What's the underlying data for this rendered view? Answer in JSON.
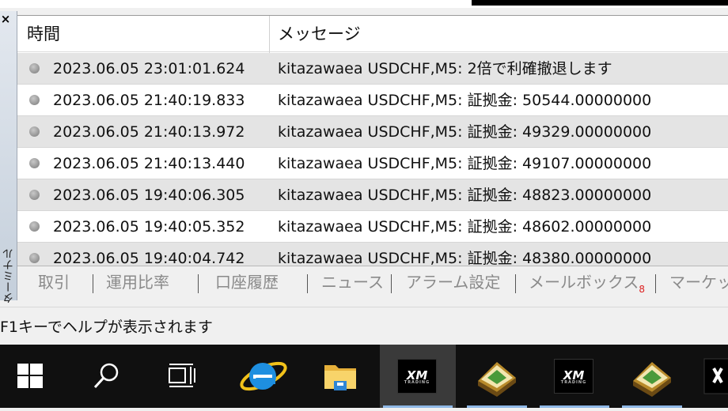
{
  "panel": {
    "close_glyph": "×",
    "side_label": "ターミナル"
  },
  "table": {
    "columns": [
      "時間",
      "メッセージ"
    ],
    "rows": [
      {
        "time": "2023.06.05 23:01:01.624",
        "message": "kitazawaea USDCHF,M5: 2倍で利確撤退します"
      },
      {
        "time": "2023.06.05 21:40:19.833",
        "message": "kitazawaea USDCHF,M5: 証拠金: 50544.00000000"
      },
      {
        "time": "2023.06.05 21:40:13.972",
        "message": "kitazawaea USDCHF,M5: 証拠金: 49329.00000000"
      },
      {
        "time": "2023.06.05 21:40:13.440",
        "message": "kitazawaea USDCHF,M5: 証拠金: 49107.00000000"
      },
      {
        "time": "2023.06.05 19:40:06.305",
        "message": "kitazawaea USDCHF,M5: 証拠金: 48823.00000000"
      },
      {
        "time": "2023.06.05 19:40:05.352",
        "message": "kitazawaea USDCHF,M5: 証拠金: 48602.00000000"
      },
      {
        "time": "2023.06.05 19:40:04.742",
        "message": "kitazawaea USDCHF,M5: 証拠金: 48380.00000000"
      }
    ]
  },
  "tabs": [
    {
      "label": "取引"
    },
    {
      "label": "運用比率"
    },
    {
      "label": "口座履歴"
    },
    {
      "label": "ニュース"
    },
    {
      "label": "アラーム設定"
    },
    {
      "label": "メールボックス",
      "badge": "8"
    },
    {
      "label": "マーケット"
    }
  ],
  "status_text": "F1キーでヘルプが表示されます",
  "taskbar": {
    "items": [
      {
        "icon": "windows-start-icon"
      },
      {
        "icon": "search-icon"
      },
      {
        "icon": "task-view-icon"
      },
      {
        "icon": "internet-explorer-icon"
      },
      {
        "icon": "file-explorer-icon"
      },
      {
        "icon": "xm-terminal-icon",
        "text": "XM",
        "sub": "TRADING"
      },
      {
        "icon": "metaeditor-icon"
      },
      {
        "icon": "xm-terminal-icon",
        "text": "XM",
        "sub": "TRADING"
      },
      {
        "icon": "metaeditor-icon"
      }
    ],
    "colors": {
      "bg": "#101010",
      "active": "#3a3a3a",
      "underline": "#8fb8e6"
    }
  }
}
